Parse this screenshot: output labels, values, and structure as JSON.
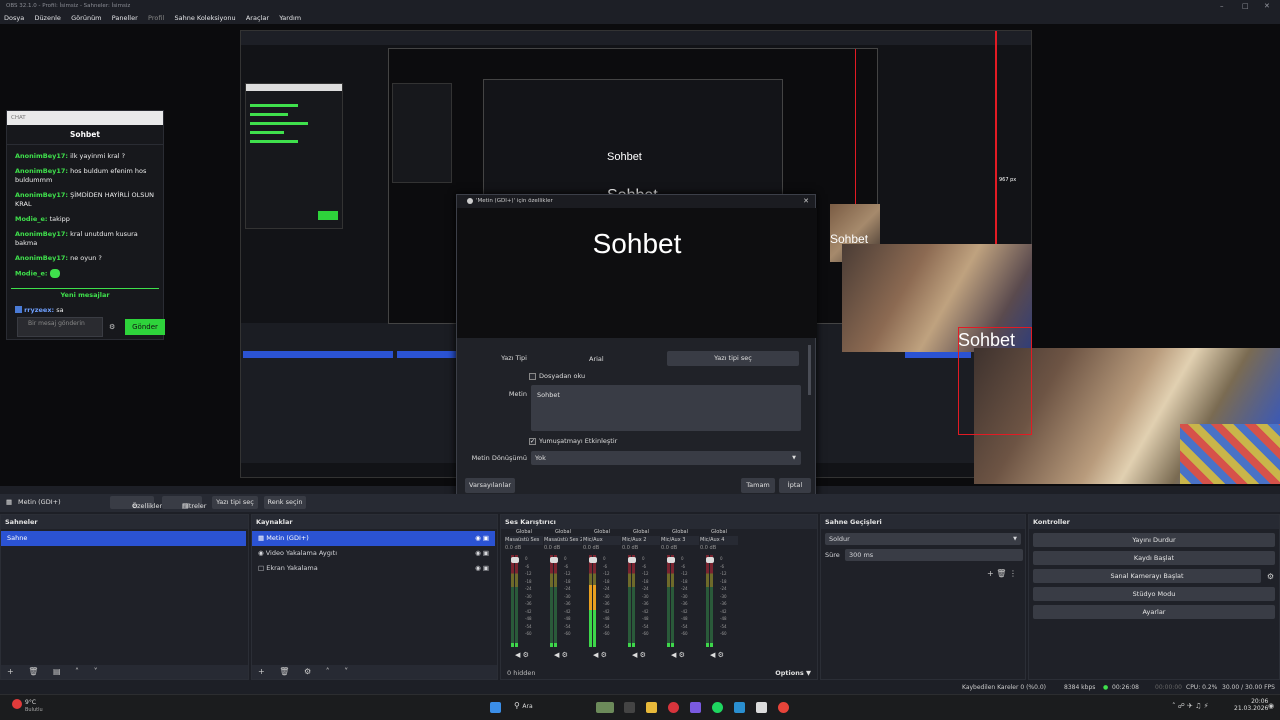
{
  "titlebar": {
    "title": "OBS 32.1.0 - Profil: İsimsiz - Sahneler: İsimsiz"
  },
  "menu": [
    "Dosya",
    "Düzenle",
    "Görünüm",
    "Paneller",
    "Profil",
    "Sahne Koleksiyonu",
    "Araçlar",
    "Yardım"
  ],
  "chat": {
    "window_label": "CHAT",
    "header": "Sohbet",
    "messages": [
      {
        "user": "AnonimBey17:",
        "text": "ilk yayinmi kral ?"
      },
      {
        "user": "AnonimBey17:",
        "text": "hos buldum efenim hos buldummm"
      },
      {
        "user": "AnonimBey17:",
        "text": "ŞİMDİDEN HAYİRLİ OLSUN KRAL"
      },
      {
        "user": "Modie_e:",
        "text": "takipp"
      },
      {
        "user": "AnonimBey17:",
        "text": "kral unutdum kusura bakma"
      },
      {
        "user": "AnonimBey17:",
        "text": "ne oyun ?"
      },
      {
        "user": "Modie_e:",
        "text": ""
      }
    ],
    "new_messages": "Yeni mesajlar",
    "last": {
      "user": "rryzeex:",
      "text": "sa"
    },
    "input_placeholder": "Bir mesaj gönderin",
    "send": "Gönder"
  },
  "overlay_text": "Sohbet",
  "nested_label": "967 px",
  "dialog": {
    "title": "'Metin (GDI+)' için özellikler",
    "preview_text": "Sohbet",
    "font_label": "Yazı Tipi",
    "font_value": "Arial",
    "font_button": "Yazı tipi seç",
    "from_file": "Dosyadan oku",
    "text_label": "Metin",
    "text_value": "Sohbet",
    "antialias": "Yumuşatmayı Etkinleştir",
    "transform_label": "Metin Dönüşümü",
    "transform_value": "Yok",
    "defaults": "Varsayılanlar",
    "ok": "Tamam",
    "cancel": "İptal"
  },
  "source_toolbar": {
    "source_name": "Metin (GDI+)",
    "properties": "Özellikler",
    "filters": "Filtreler",
    "select_font": "Yazı tipi seç",
    "select_color": "Renk seçin"
  },
  "scenes": {
    "title": "Sahneler",
    "items": [
      "Sahne"
    ]
  },
  "sources": {
    "title": "Kaynaklar",
    "items": [
      "Metin (GDI+)",
      "Video Yakalama Aygıtı",
      "Ekran Yakalama"
    ]
  },
  "mixer": {
    "title": "Ses Karıştırıcı",
    "channels": [
      {
        "name": "Masaüstü Ses",
        "db": "0.0 dB"
      },
      {
        "name": "Masaüstü Ses 2",
        "db": "0.0 dB"
      },
      {
        "name": "Mic/Aux",
        "db": "0.0 dB"
      },
      {
        "name": "Mic/Aux 2",
        "db": "0.0 dB"
      },
      {
        "name": "Mic/Aux 3",
        "db": "0.0 dB"
      },
      {
        "name": "Mic/Aux 4",
        "db": "0.0 dB"
      }
    ],
    "global": "Global",
    "hidden": "0 hidden",
    "options": "Options"
  },
  "transitions": {
    "title": "Sahne Geçişleri",
    "type": "Soldur",
    "duration_label": "Süre",
    "duration": "300 ms"
  },
  "controls": {
    "title": "Kontroller",
    "buttons": [
      "Yayını Durdur",
      "Kaydı Başlat",
      "Sanal Kamerayı Başlat",
      "Stüdyo Modu",
      "Ayarlar"
    ]
  },
  "status": {
    "dropped": "Kaybedilen Kareler 0 (%0.0)",
    "kbps": "8384 kbps",
    "stream_time": "00:26:08",
    "rec_time": "00:00:00",
    "cpu": "CPU: 0.2%",
    "fps": "30.00 / 30.00 FPS"
  },
  "taskbar": {
    "temp": "9°C",
    "weather": "Bulutlu",
    "search": "Ara",
    "time": "20:06",
    "date": "21.03.2026"
  }
}
